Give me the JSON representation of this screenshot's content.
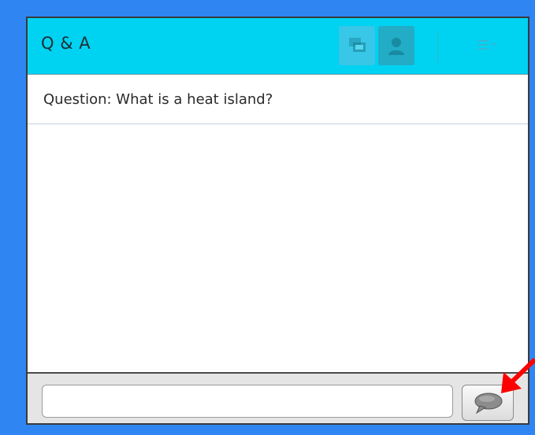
{
  "pod": {
    "title": "Q & A"
  },
  "toolbar": {
    "view_buttons": [
      "shared-screen-icon",
      "presenter-icon"
    ],
    "menu_icon": "menu-list-icon"
  },
  "question": {
    "text": "Question: What is a heat island?"
  },
  "composer": {
    "input_value": "",
    "send_icon": "speech-bubble-icon"
  },
  "colors": {
    "page_background": "#2f86f2",
    "header": "#00d2f2",
    "annotation_arrow": "#ff0000"
  }
}
